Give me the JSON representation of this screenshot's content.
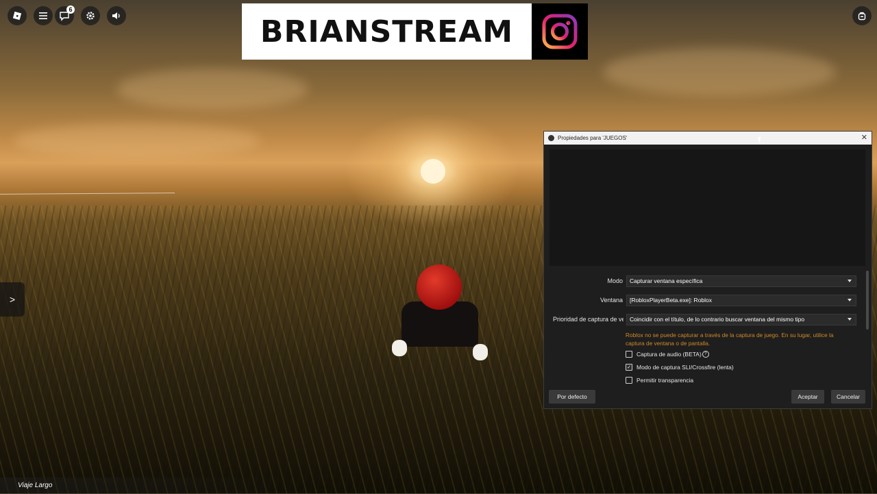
{
  "toolbar": {
    "chat_badge": "6",
    "icons": [
      "roblox-logo-icon",
      "menu-icon",
      "chat-icon",
      "settings-icon",
      "volume-icon",
      "backpack-icon"
    ]
  },
  "banner": {
    "text": "BRIANSTREAM",
    "logo": "instagram-logo"
  },
  "side_toggle": ">",
  "bottom_label": "Viaje Largo",
  "dialog": {
    "title": "Propiedades para 'JUEGOS'",
    "close": "✕",
    "modo_label": "Modo",
    "modo_value": "Capturar ventana específica",
    "ventana_label": "Ventana",
    "ventana_value": "[RobloxPlayerBeta.exe]: Roblox",
    "prioridad_label": "Prioridad de captura de ve",
    "prioridad_value": "Coincidir con el título, de lo contrario buscar ventana del mismo tipo",
    "warning": "Roblox no se puede capturar a través de la captura de juego. En su lugar, utilice la captura de ventana o de pantalla.",
    "checkboxes": [
      {
        "label": "Captura de audio (BETA)",
        "checked": false,
        "help": "?"
      },
      {
        "label": "Modo de captura SLI/Crossfire (lenta)",
        "checked": true
      },
      {
        "label": "Permitir transparencia",
        "checked": false
      }
    ],
    "defaults_button": "Por defecto",
    "accept_button": "Aceptar",
    "cancel_button": "Cancelar"
  }
}
